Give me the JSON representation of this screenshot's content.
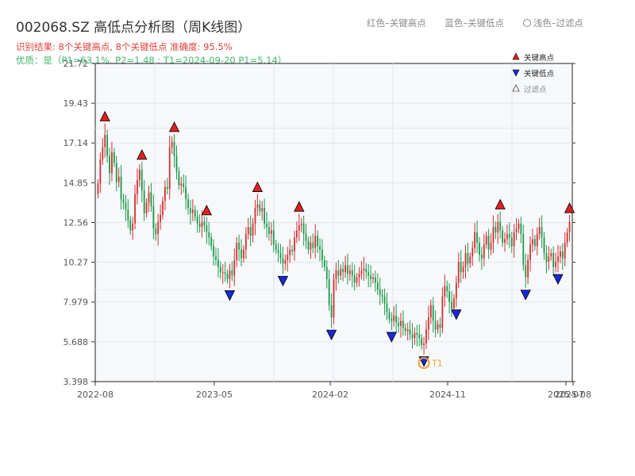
{
  "header": {
    "title": "002068.SZ 高低点分析图（周K线图）",
    "result": "识别结果: 8个关键高点, 8个关键低点  准确度: 95.5%",
    "quality": "优质：是（P1=63.1%, P2=1.48 ; T1=2024-09-20 P1=5.14）",
    "legend_high": "红色–关键高点",
    "legend_low": "蓝色–关键低点",
    "legend_filtered": "浅色–过滤点"
  },
  "colors": {
    "up": "#d32f2f",
    "down": "#1a9a4a",
    "high": "#e02020",
    "low": "#1a28d8",
    "t1": "#f0a030",
    "plot_bg": "#f6f8fa"
  },
  "chart_data": {
    "type": "candlestick",
    "ylim": [
      3.398,
      21.72
    ],
    "yticks": [
      "3.398",
      "5.688",
      "7.979",
      "10.27",
      "12.56",
      "14.85",
      "17.14",
      "19.43",
      "21.72"
    ],
    "xtick_labels": [
      "2022-08",
      "2023-05",
      "2024-02",
      "2024-11",
      "2025-07",
      "2025-08"
    ],
    "legend": [
      "关键高点",
      "关键低点",
      "过滤点"
    ],
    "t1_label": "T1",
    "closes": [
      14.8,
      16.2,
      16.9,
      17.6,
      16.4,
      15.4,
      16.6,
      16.0,
      14.9,
      15.2,
      13.9,
      13.7,
      13.3,
      12.7,
      12.1,
      12.5,
      14.2,
      15.0,
      15.6,
      14.4,
      13.1,
      13.7,
      14.3,
      13.5,
      12.2,
      11.9,
      12.6,
      13.0,
      13.8,
      14.6,
      14.5,
      16.9,
      17.2,
      16.4,
      15.5,
      14.7,
      14.8,
      14.6,
      13.9,
      13.4,
      13.1,
      13.3,
      12.9,
      12.5,
      12.3,
      12.6,
      12.4,
      12.0,
      11.7,
      11.2,
      10.6,
      10.4,
      10.0,
      9.7,
      9.7,
      9.6,
      9.3,
      9.8,
      9.5,
      10.4,
      11.4,
      11.0,
      10.5,
      11.0,
      11.9,
      12.3,
      11.8,
      12.5,
      13.4,
      13.6,
      13.2,
      13.4,
      12.5,
      12.3,
      11.9,
      12.1,
      11.3,
      11.0,
      10.8,
      10.5,
      10.2,
      10.4,
      10.7,
      11.0,
      10.9,
      11.7,
      12.1,
      12.4,
      12.5,
      11.9,
      11.5,
      11.0,
      11.4,
      11.1,
      11.8,
      11.2,
      11.0,
      10.4,
      10.0,
      9.3,
      7.8,
      7.1,
      9.3,
      9.8,
      9.5,
      9.9,
      9.7,
      10.1,
      9.6,
      9.8,
      9.5,
      9.1,
      9.4,
      9.6,
      9.8,
      9.9,
      9.7,
      9.5,
      9.3,
      9.4,
      9.1,
      8.7,
      8.4,
      8.3,
      7.9,
      7.4,
      7.0,
      6.9,
      7.2,
      6.8,
      6.6,
      6.9,
      6.5,
      6.3,
      6.4,
      6.1,
      5.9,
      6.2,
      6.1,
      5.9,
      5.5,
      5.6,
      6.4,
      7.1,
      7.8,
      6.9,
      6.4,
      6.7,
      6.5,
      8.3,
      8.9,
      8.6,
      8.0,
      7.6,
      8.2,
      9.1,
      10.3,
      9.7,
      10.0,
      10.8,
      10.2,
      10.6,
      11.1,
      12.0,
      11.4,
      10.7,
      10.5,
      11.3,
      11.8,
      11.0,
      11.4,
      12.3,
      12.0,
      12.6,
      12.1,
      11.4,
      11.6,
      11.9,
      11.7,
      11.2,
      12.0,
      12.2,
      12.5,
      11.9,
      10.1,
      9.4,
      10.4,
      11.3,
      11.6,
      11.2,
      11.9,
      12.3,
      11.7,
      10.8,
      10.3,
      10.6,
      10.8,
      10.0,
      10.3,
      10.6,
      10.9,
      10.5,
      11.4,
      12.0,
      12.6
    ]
  }
}
